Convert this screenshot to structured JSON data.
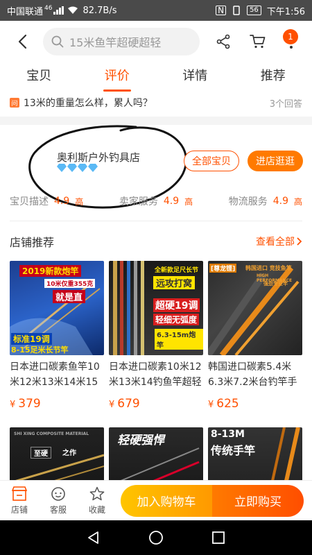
{
  "status_bar": {
    "carrier": "中国联通",
    "signal": "46",
    "speed": "82.7B/s",
    "battery": "56",
    "time": "下午1:56"
  },
  "header": {
    "search_placeholder": "15米鱼竿超硬超轻",
    "more_badge": "1"
  },
  "tabs": [
    {
      "label": "宝贝",
      "active": false
    },
    {
      "label": "评价",
      "active": true
    },
    {
      "label": "详情",
      "active": false
    },
    {
      "label": "推荐",
      "active": false
    }
  ],
  "question": {
    "icon_text": "问",
    "text": "13米的重量怎么样，累人吗？",
    "answers": "3个回答"
  },
  "shop": {
    "name": "奥利斯户外钓具店",
    "diamonds": 4,
    "btn_all": "全部宝贝",
    "btn_visit": "进店逛逛",
    "ratings": [
      {
        "label": "宝贝描述",
        "score": "4.9",
        "level": "高"
      },
      {
        "label": "卖家服务",
        "score": "4.9",
        "level": "高"
      },
      {
        "label": "物流服务",
        "score": "4.9",
        "level": "高"
      }
    ]
  },
  "recommend": {
    "title": "店铺推荐",
    "more": "查看全部",
    "items": [
      {
        "name": "日本进口碳素鱼竿10米12米13米14米15米超轻超硬",
        "price": "379",
        "tag_top": "2019新款炮竿",
        "tag_mid": "10米仅重355克",
        "tag_mid2": "就是直",
        "tag_bottom": "标准19调",
        "tag_bottom2": "8-15足米长节竿"
      },
      {
        "name": "日本进口碳素10米12米13米14钓鱼竿超轻超硬",
        "price": "679",
        "tag_top": "全新款足尺长节",
        "tag_mid": "远攻打窝",
        "tag_mid2": "超硬19调",
        "tag_bottom": "轻细无弧度",
        "tag_bottom2": "6.3-15m炮竿"
      },
      {
        "name": "韩国进口碳素5.4米6.3米7.2米台钓竿手竿",
        "price": "625",
        "tag_top": "[尊龙铿]",
        "tag_mid": "韩国进口 竞技鱼竿",
        "tag_mid2": "HIGH PERFORMANCE",
        "tag_bottom": "强劲专业竿",
        "tag_bottom2": ""
      },
      {
        "name": "",
        "price": "",
        "tag_top": "SHI XING COMPOSITE MATERIAL",
        "tag_mid": "至硬",
        "tag_mid2": "之作",
        "tag_bottom": "",
        "tag_bottom2": ""
      },
      {
        "name": "",
        "price": "",
        "tag_top": "轻硬强悍",
        "tag_mid": "",
        "tag_mid2": "",
        "tag_bottom": "",
        "tag_bottom2": ""
      },
      {
        "name": "",
        "price": "",
        "tag_top": "8-13M",
        "tag_mid": "传统手竿",
        "tag_mid2": "",
        "tag_bottom": "",
        "tag_bottom2": ""
      }
    ]
  },
  "bottom_bar": {
    "shop": "店铺",
    "service": "客服",
    "favorite": "收藏",
    "add_cart": "加入购物车",
    "buy_now": "立即购买"
  },
  "colors": {
    "accent": "#ff5000",
    "cart_button": "#ff9900",
    "buy_button": "#ff4e00"
  }
}
